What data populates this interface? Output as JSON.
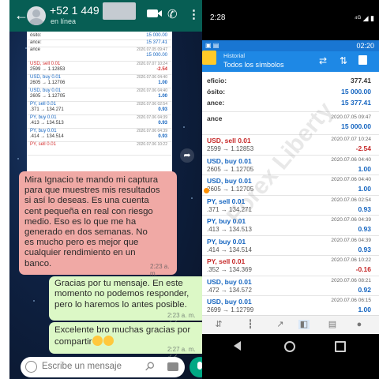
{
  "whatsapp": {
    "contact_name": "+52 1 449",
    "contact_status": "en línea",
    "card": {
      "rows": [
        {
          "label": "ósito:",
          "value": "15 000.00",
          "blue": true
        },
        {
          "label": "ance:",
          "value": "15 377.41",
          "blue": true
        },
        {
          "label": "ance",
          "date": "2020.07.05 09:47",
          "value": "15 000.00",
          "blue": true
        },
        {
          "symbol": "USD, sell 0.01",
          "date": "2020.07.07 10:24",
          "prices": "2599 → 1.12853",
          "value": "-2.54",
          "red": true
        },
        {
          "symbol": "USD, buy 0.01",
          "date": "2020.07.06 04:40",
          "prices": "2605 → 1.12706",
          "value": "1.00",
          "blue": true
        },
        {
          "symbol": "USD, buy 0.01",
          "date": "2020.07.06 04:40",
          "prices": "2605 → 1.12705",
          "value": "1.00",
          "blue": true
        },
        {
          "symbol": "PY, sell 0.01",
          "date": "2020.07.06 02:54",
          "prices": ".371 → 134.271",
          "value": "0.93",
          "blue": true
        },
        {
          "symbol": "PY, buy 0.01",
          "date": "2020.07.06 04:39",
          "prices": ".413 → 134.513",
          "value": "0.93",
          "blue": true
        },
        {
          "symbol": "PY, buy 0.01",
          "date": "2020.07.06 04:39",
          "prices": ".414 → 134.514",
          "value": "0.93",
          "blue": true
        },
        {
          "symbol": "PY, sell 0.01",
          "date": "2020.07.06 10:22",
          "prices": "",
          "value": "",
          "red": true
        }
      ]
    },
    "incoming_message": "Mira Ignacio te mando mi captura\npara que muestres mis resultados\nsi así lo deseas. Es una cuenta\ncent pequeña en real con riesgo\nmedio. Eso es lo que me ha\ngenerado en dos semanas. No\nes mucho pero es mejor que\ncualquier rendimiento en un\nbanco.",
    "incoming_time": "2:23 a. m.",
    "outgoing_1": "Gracias por tu mensaje. En este\nmomento no podemos responder,\npero lo haremos lo antes posible.",
    "outgoing_1_time": "2:23 a. m. ✓✓",
    "outgoing_2": "Excelente bro muchas gracias por\ncompartir",
    "outgoing_2_time": "2:27 a. m. ✓✓",
    "composer_placeholder": "Escribe un mensaje"
  },
  "mt4": {
    "phone_time": "2:28",
    "status_right": "⁴ᴳ ◢ ▮",
    "top_clock": "02:20",
    "title": "Historial",
    "subtitle": "Todos los símbolos",
    "summary": [
      {
        "label": "eficio:",
        "value": "377.41"
      },
      {
        "label": "ósito:",
        "value": "15 000.00"
      },
      {
        "label": "ance:",
        "value": "15 377.41"
      }
    ],
    "balance_row": {
      "label": "ance",
      "date": "2020.07.05 09:47",
      "value": "15 000.00"
    },
    "trades": [
      {
        "symbol": "USD, sell 0.01",
        "prices": "2599 → 1.12853",
        "date": "2020.07.07 10:24",
        "value": "-2.54",
        "neg": true
      },
      {
        "symbol": "USD, buy 0.01",
        "prices": "2605 → 1.12705",
        "date": "2020.07.06 04:40",
        "value": "1.00",
        "neg": false
      },
      {
        "symbol": "USD, buy 0.01",
        "prices": "2605 → 1.12705",
        "date": "2020.07.06 04:40",
        "value": "1.00",
        "neg": false
      },
      {
        "symbol": "PY, sell 0.01",
        "prices": ".371 → 134.271",
        "date": "2020.07.06 02:54",
        "value": "0.93",
        "neg": false
      },
      {
        "symbol": "PY, buy 0.01",
        "prices": ".413 → 134.513",
        "date": "2020.07.06 04:39",
        "value": "0.93",
        "neg": false
      },
      {
        "symbol": "PY, buy 0.01",
        "prices": ".414 → 134.514",
        "date": "2020.07.06 04:39",
        "value": "0.93",
        "neg": false
      },
      {
        "symbol": "PY, sell 0.01",
        "prices": ".352 → 134.369",
        "date": "2020.07.06 10:22",
        "value": "-0.16",
        "neg": true
      },
      {
        "symbol": "USD, buy 0.01",
        "prices": ".472 → 134.572",
        "date": "2020.07.06 08:21",
        "value": "0.92",
        "neg": false
      },
      {
        "symbol": "USD, buy 0.01",
        "prices": "2699 → 1.12799",
        "date": "2020.07.06 06:15",
        "value": "1.00",
        "neg": false
      }
    ],
    "watermark": "Forex Liberty"
  }
}
